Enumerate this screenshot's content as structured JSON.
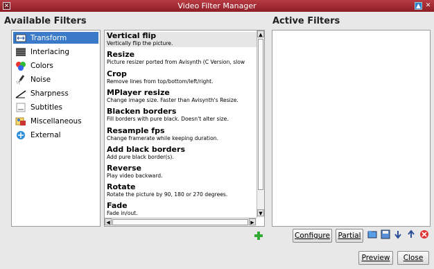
{
  "window": {
    "title": "Video Filter Manager",
    "max_glyph": "▲",
    "close_glyph": "✕"
  },
  "headings": {
    "available": "Available Filters",
    "active": "Active Filters"
  },
  "categories": [
    {
      "label": "Transform",
      "icon": "transform-icon",
      "selected": true
    },
    {
      "label": "Interlacing",
      "icon": "interlacing-icon"
    },
    {
      "label": "Colors",
      "icon": "colors-icon"
    },
    {
      "label": "Noise",
      "icon": "noise-icon"
    },
    {
      "label": "Sharpness",
      "icon": "sharpness-icon"
    },
    {
      "label": "Subtitles",
      "icon": "subtitles-icon"
    },
    {
      "label": "Miscellaneous",
      "icon": "miscellaneous-icon"
    },
    {
      "label": "External",
      "icon": "external-icon"
    }
  ],
  "filters": [
    {
      "name": "Vertical flip",
      "desc": "Vertically flip the picture.",
      "selected": true
    },
    {
      "name": "Resize",
      "desc": "Picture resizer ported from Avisynth (C Version, slow"
    },
    {
      "name": "Crop",
      "desc": "Remove lines from top/bottom/left/right."
    },
    {
      "name": "MPlayer resize",
      "desc": "Change image size. Faster than Avisynth's Resize."
    },
    {
      "name": "Blacken borders",
      "desc": "Fill borders with pure black. Doesn't alter size."
    },
    {
      "name": "Resample fps",
      "desc": "Change framerate while keeping duration."
    },
    {
      "name": "Add black borders",
      "desc": "Add pure black border(s)."
    },
    {
      "name": "Reverse",
      "desc": "Play video backward."
    },
    {
      "name": "Rotate",
      "desc": "Rotate the picture by 90, 180 or 270 degrees."
    },
    {
      "name": "Fade",
      "desc": "Fade in/out."
    }
  ],
  "buttons": {
    "configure": "Configure",
    "partial": "Partial",
    "preview": "Preview",
    "close": "Close",
    "add_icon": "add-filter-icon",
    "toolbar_icons": [
      "open-icon",
      "save-icon",
      "move-down-icon",
      "move-up-icon",
      "remove-icon"
    ]
  },
  "colors": {
    "titlebar": "#a32a32",
    "selection": "#3a7ac8"
  }
}
